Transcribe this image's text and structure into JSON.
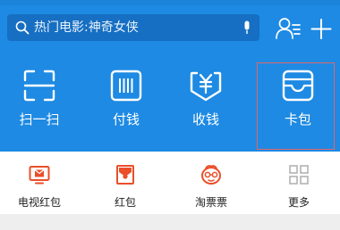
{
  "search": {
    "placeholder": "热门电影:神奇女侠",
    "icon": "search-icon",
    "voice_icon": "microphone-icon"
  },
  "header_icons": {
    "contacts": "contacts-icon",
    "add": "plus-icon"
  },
  "actions": [
    {
      "label": "扫一扫",
      "icon": "scan-icon"
    },
    {
      "label": "付钱",
      "icon": "barcode-icon"
    },
    {
      "label": "收钱",
      "icon": "yuan-receipt-icon"
    },
    {
      "label": "卡包",
      "icon": "wallet-icon"
    }
  ],
  "shortcuts": [
    {
      "label": "电视红包",
      "icon": "tv-red-envelope-icon"
    },
    {
      "label": "红包",
      "icon": "red-envelope-icon"
    },
    {
      "label": "淘票票",
      "icon": "taopiaopiao-icon"
    },
    {
      "label": "更多",
      "icon": "more-grid-icon"
    }
  ],
  "colors": {
    "header_blue": "#1e8ae3",
    "search_blue": "#166fc2",
    "shortcut_orange": "#ea4f2a",
    "highlight_red": "#e2666a"
  }
}
